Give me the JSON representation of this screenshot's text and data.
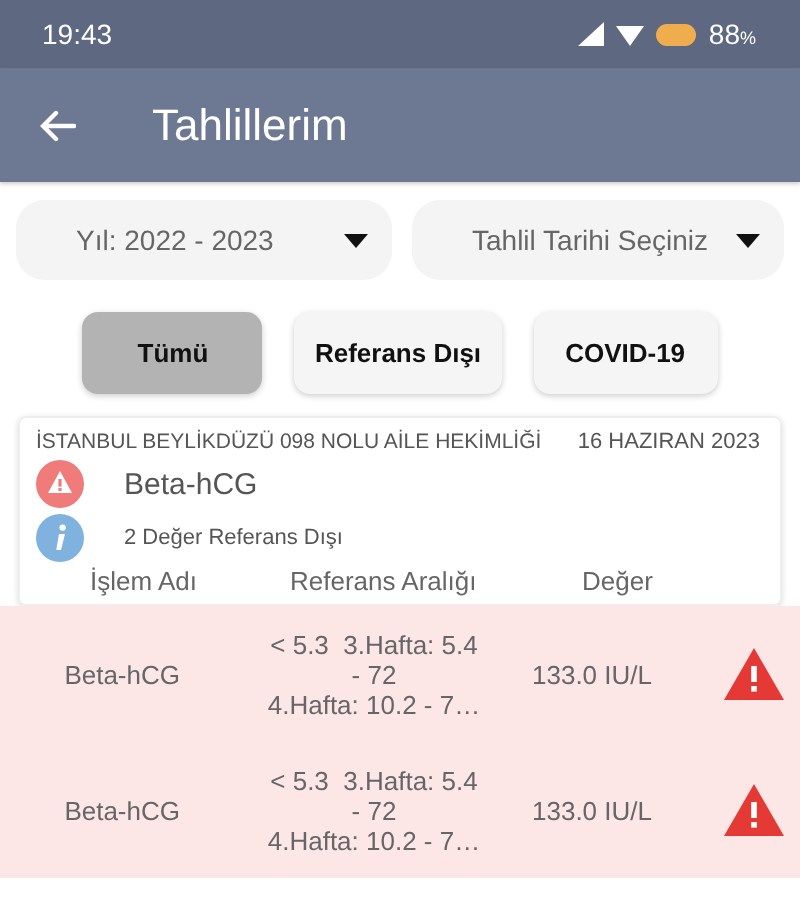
{
  "status_bar": {
    "time": "19:43",
    "battery": "88",
    "battery_unit": "%"
  },
  "app_bar": {
    "title": "Tahlillerim"
  },
  "dropdowns": [
    {
      "value": "Yıl: 2022 - 2023"
    },
    {
      "placeholder": "Tahlil Tarihi Seçiniz"
    }
  ],
  "filters": [
    {
      "label": "Tümü",
      "selected": true
    },
    {
      "label": "Referans Dışı",
      "selected": false
    },
    {
      "label": "COVID-19",
      "selected": false
    }
  ],
  "card": {
    "facility": "İSTANBUL BEYLİKDÜZÜ 098 NOLU AİLE HEKİMLİĞİ",
    "date": "16 HAZIRAN 2023",
    "test_name": "Beta-hCG",
    "note": "2 Değer Referans Dışı",
    "columns": [
      "İşlem Adı",
      "Referans Aralığı",
      "Değer"
    ]
  },
  "rows": [
    {
      "name": "Beta-hCG",
      "reference": [
        "< 5.3  3.Hafta: 5.4",
        "- 72",
        "4.Hafta: 10.2 - 7…"
      ],
      "value": "133.0 IU/L",
      "out_of_range": true
    },
    {
      "name": "Beta-hCG",
      "reference": [
        "< 5.3  3.Hafta: 5.4",
        "- 72",
        "4.Hafta: 10.2 - 7…"
      ],
      "value": "133.0 IU/L",
      "out_of_range": true
    }
  ]
}
